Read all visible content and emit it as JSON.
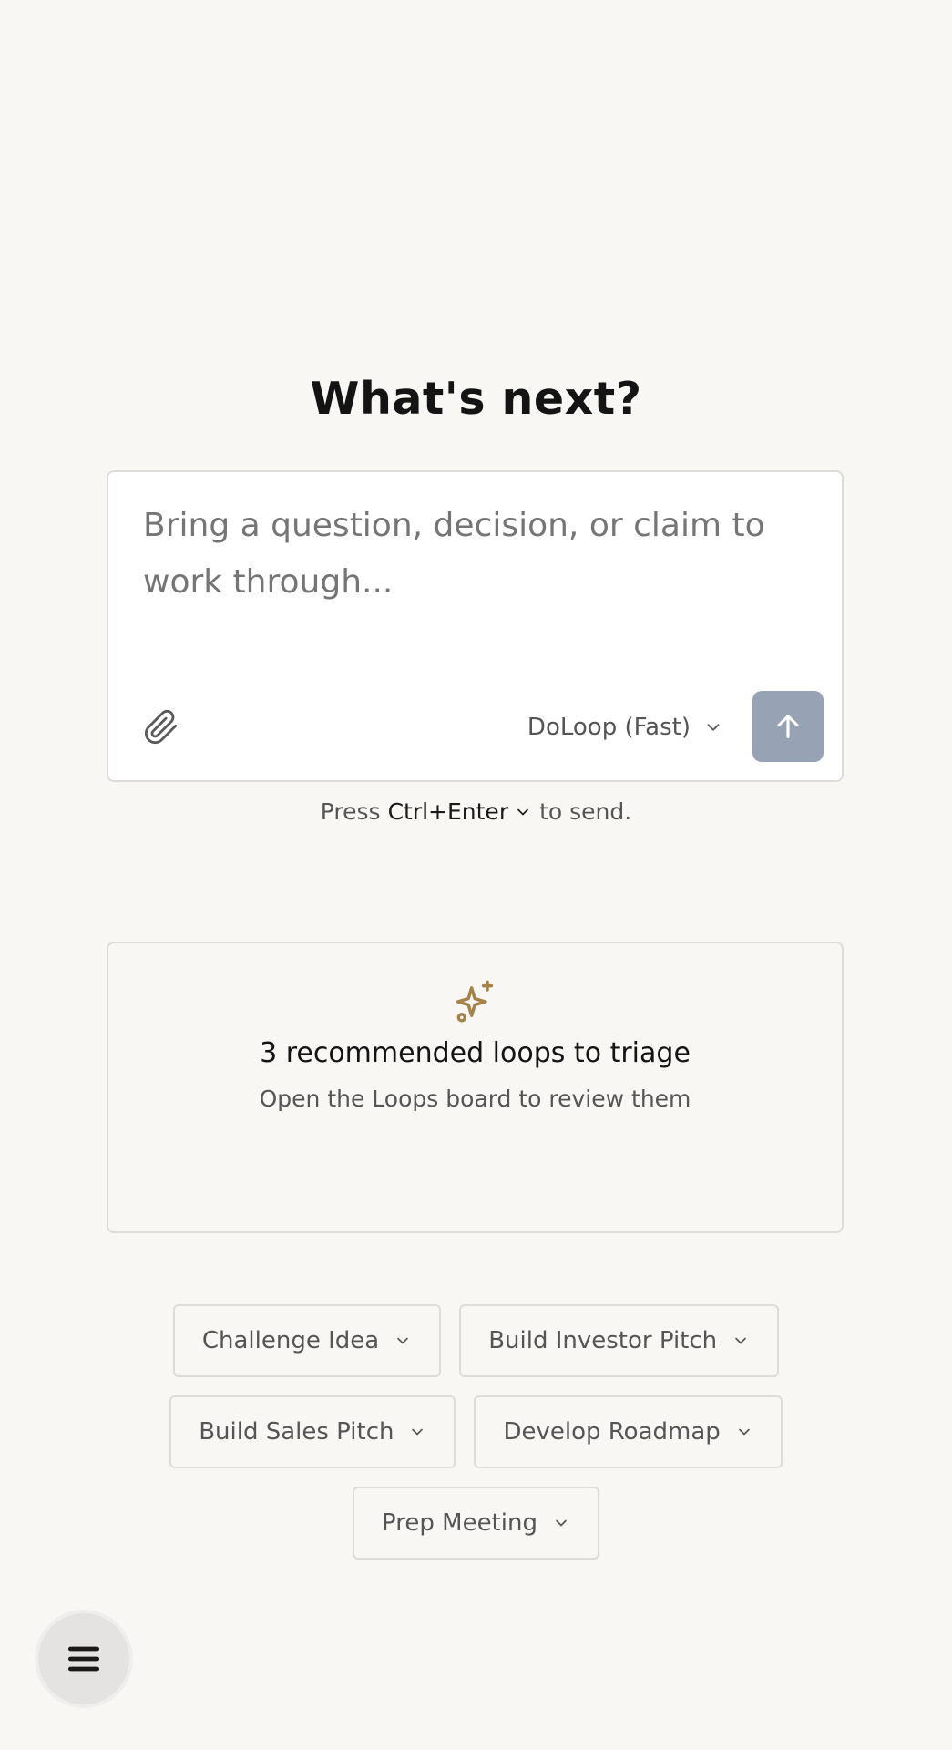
{
  "page": {
    "title": "What's next?"
  },
  "composer": {
    "placeholder": "Bring a question, decision, or claim to work through...",
    "model_label": "DoLoop (Fast)",
    "attach_icon": "paperclip-icon",
    "send_icon": "arrow-up-icon",
    "send_color": "#97a3b4"
  },
  "hint": {
    "prefix": "Press",
    "shortcut": "Ctrl+Enter",
    "suffix": "to send."
  },
  "recommendations": {
    "icon": "sparkle-icon",
    "icon_color": "#a4824a",
    "title": "3 recommended loops to triage",
    "subtitle": "Open the Loops board to review them"
  },
  "actions": {
    "rows": [
      [
        "Challenge Idea",
        "Build Investor Pitch"
      ],
      [
        "Build Sales Pitch",
        "Develop Roadmap"
      ],
      [
        "Prep Meeting"
      ]
    ]
  },
  "menu": {
    "icon": "hamburger-menu-icon"
  }
}
